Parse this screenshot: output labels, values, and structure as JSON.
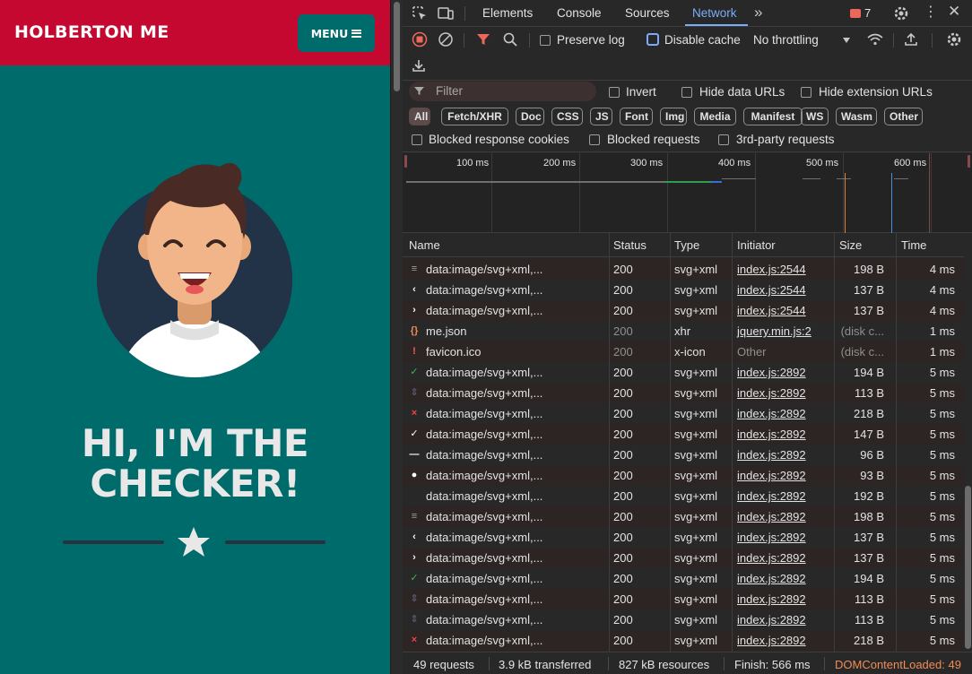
{
  "page": {
    "brand": "HOLBERTON ME",
    "menu_label": "MENU",
    "hero_line1": "HI, I'M THE",
    "hero_line2": "CHECKER!"
  },
  "devtools": {
    "tabs": [
      "Elements",
      "Console",
      "Sources",
      "Network"
    ],
    "active_tab": "Network",
    "issues_count": "7",
    "toolbar": {
      "preserve_log": "Preserve log",
      "disable_cache": "Disable cache",
      "throttling": "No throttling"
    },
    "filter": {
      "placeholder": "Filter",
      "invert": "Invert",
      "hide_data_urls": "Hide data URLs",
      "hide_extension_urls": "Hide extension URLs",
      "blocked_cookies": "Blocked response cookies",
      "blocked_requests": "Blocked requests",
      "third_party": "3rd-party requests"
    },
    "chips": [
      "All",
      "Fetch/XHR",
      "Doc",
      "CSS",
      "JS",
      "Font",
      "Img",
      "Media",
      "Manifest",
      "WS",
      "Wasm",
      "Other"
    ],
    "active_chip": "All",
    "overview": {
      "ticks": [
        "100 ms",
        "200 ms",
        "300 ms",
        "400 ms",
        "500 ms",
        "600 ms"
      ]
    },
    "columns": {
      "name": "Name",
      "status": "Status",
      "type": "Type",
      "initiator": "Initiator",
      "size": "Size",
      "time": "Time"
    },
    "rows": [
      {
        "icon": "menu-icon",
        "name": "data:image/svg+xml,...",
        "status": "200",
        "type": "svg+xml",
        "initiator": "index.js:2544",
        "size": "198 B",
        "time": "4 ms"
      },
      {
        "icon": "chevron-left-icon",
        "name": "data:image/svg+xml,...",
        "status": "200",
        "type": "svg+xml",
        "initiator": "index.js:2544",
        "size": "137 B",
        "time": "4 ms"
      },
      {
        "icon": "chevron-right-icon",
        "name": "data:image/svg+xml,...",
        "status": "200",
        "type": "svg+xml",
        "initiator": "index.js:2544",
        "size": "137 B",
        "time": "4 ms"
      },
      {
        "icon": "json-icon",
        "name": "me.json",
        "status": "200",
        "type": "xhr",
        "initiator": "jquery.min.js:2",
        "size": "(disk c...",
        "time": "1 ms",
        "muted": true
      },
      {
        "icon": "favicon-icon",
        "name": "favicon.ico",
        "status": "200",
        "type": "x-icon",
        "initiator": "Other",
        "size": "(disk c...",
        "time": "1 ms",
        "muted": true,
        "plain_initiator": true
      },
      {
        "icon": "check-green-icon",
        "name": "data:image/svg+xml,...",
        "status": "200",
        "type": "svg+xml",
        "initiator": "index.js:2892",
        "size": "194 B",
        "time": "5 ms"
      },
      {
        "icon": "sort-icon",
        "name": "data:image/svg+xml,...",
        "status": "200",
        "type": "svg+xml",
        "initiator": "index.js:2892",
        "size": "113 B",
        "time": "5 ms"
      },
      {
        "icon": "cross-red-icon",
        "name": "data:image/svg+xml,...",
        "status": "200",
        "type": "svg+xml",
        "initiator": "index.js:2892",
        "size": "218 B",
        "time": "5 ms"
      },
      {
        "icon": "check-white-icon",
        "name": "data:image/svg+xml,...",
        "status": "200",
        "type": "svg+xml",
        "initiator": "index.js:2892",
        "size": "147 B",
        "time": "5 ms"
      },
      {
        "icon": "dash-icon",
        "name": "data:image/svg+xml,...",
        "status": "200",
        "type": "svg+xml",
        "initiator": "index.js:2892",
        "size": "96 B",
        "time": "5 ms"
      },
      {
        "icon": "dot-icon",
        "name": "data:image/svg+xml,...",
        "status": "200",
        "type": "svg+xml",
        "initiator": "index.js:2892",
        "size": "93 B",
        "time": "5 ms"
      },
      {
        "icon": "blank-icon",
        "name": "data:image/svg+xml,...",
        "status": "200",
        "type": "svg+xml",
        "initiator": "index.js:2892",
        "size": "192 B",
        "time": "5 ms"
      },
      {
        "icon": "menu-icon",
        "name": "data:image/svg+xml,...",
        "status": "200",
        "type": "svg+xml",
        "initiator": "index.js:2892",
        "size": "198 B",
        "time": "5 ms"
      },
      {
        "icon": "chevron-left-icon",
        "name": "data:image/svg+xml,...",
        "status": "200",
        "type": "svg+xml",
        "initiator": "index.js:2892",
        "size": "137 B",
        "time": "5 ms"
      },
      {
        "icon": "chevron-right-icon",
        "name": "data:image/svg+xml,...",
        "status": "200",
        "type": "svg+xml",
        "initiator": "index.js:2892",
        "size": "137 B",
        "time": "5 ms"
      },
      {
        "icon": "check-green-icon",
        "name": "data:image/svg+xml,...",
        "status": "200",
        "type": "svg+xml",
        "initiator": "index.js:2892",
        "size": "194 B",
        "time": "5 ms"
      },
      {
        "icon": "sort-icon",
        "name": "data:image/svg+xml,...",
        "status": "200",
        "type": "svg+xml",
        "initiator": "index.js:2892",
        "size": "113 B",
        "time": "5 ms"
      },
      {
        "icon": "sort-icon",
        "name": "data:image/svg+xml,...",
        "status": "200",
        "type": "svg+xml",
        "initiator": "index.js:2892",
        "size": "113 B",
        "time": "5 ms"
      },
      {
        "icon": "cross-red-icon",
        "name": "data:image/svg+xml,...",
        "status": "200",
        "type": "svg+xml",
        "initiator": "index.js:2892",
        "size": "218 B",
        "time": "5 ms"
      }
    ],
    "status_bar": {
      "requests": "49 requests",
      "transferred": "3.9 kB transferred",
      "resources": "827 kB resources",
      "finish": "Finish: 566 ms",
      "dcl": "DOMContentLoaded: 49"
    },
    "colors": {
      "accent_blue": "#7cacf8",
      "brand_red": "#c4082f",
      "page_teal": "#006b6b",
      "dcl_orange": "#f28b54"
    }
  }
}
